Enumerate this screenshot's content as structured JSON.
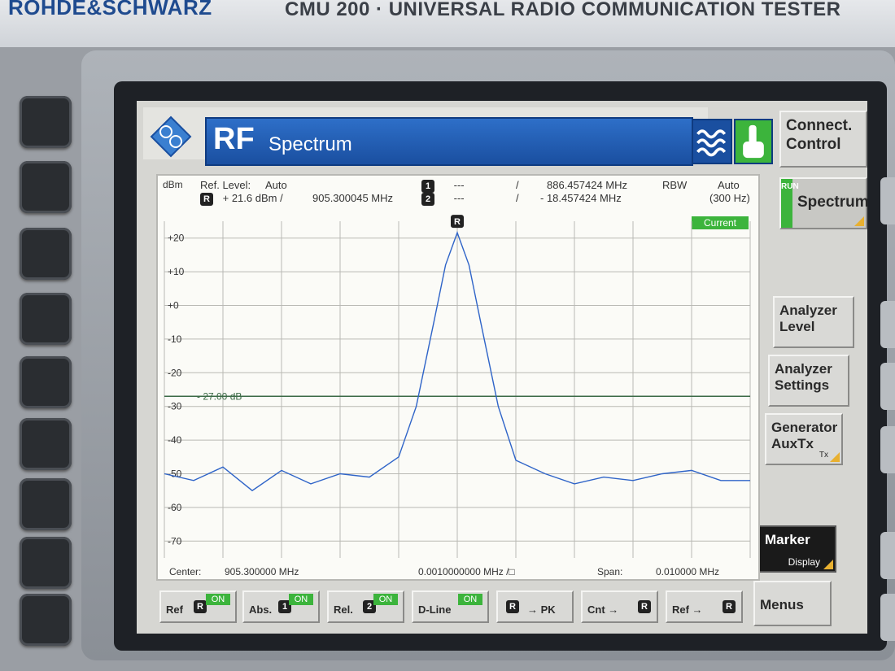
{
  "bezel": {
    "brand": "ROHDE&SCHWARZ",
    "model": "CMU 200 · UNIVERSAL RADIO COMMUNICATION TESTER"
  },
  "header": {
    "title_rf": "RF",
    "title_sub": "Spectrum",
    "connect_control": "Connect. Control"
  },
  "side_menu": {
    "run_letters": "RUN",
    "spectrum": "Spectrum",
    "analyzer_level": "Analyzer Level",
    "analyzer_settings": "Analyzer Settings",
    "generator": "Generator AuxTx",
    "generator_sub": "Tx",
    "marker": "Marker",
    "marker_sub": "Display",
    "menus": "Menus"
  },
  "readout": {
    "unit": "dBm",
    "ref_level_label": "Ref. Level:",
    "ref_level_value": "Auto",
    "ref_marker": "+ 21.6  dBm  /",
    "ref_freq": "905.300045  MHz",
    "m1_value": "---",
    "m1_freq": "886.457424   MHz",
    "m2_value": "---",
    "m2_freq": "- 18.457424   MHz",
    "rbw_label": "RBW",
    "rbw_value": "Auto",
    "rbw_detail": "(300 Hz)",
    "slash": "/",
    "current": "Current",
    "dline": "- 27.00 dB"
  },
  "bottom_info": {
    "center_label": "Center:",
    "center_value": "905.300000  MHz",
    "div_value": "0.0010000000 MHz  /□",
    "span_label": "Span:",
    "span_value": "0.010000  MHz"
  },
  "bottom_buttons": [
    {
      "label": "Ref",
      "on": "ON"
    },
    {
      "label": "Abs.",
      "on": "ON"
    },
    {
      "label": "Rel.",
      "on": "ON"
    },
    {
      "label": "D-Line",
      "on": "ON"
    },
    {
      "label": "→ PK"
    },
    {
      "label": "Cnt →"
    },
    {
      "label": "Ref →"
    }
  ],
  "chart_data": {
    "type": "line",
    "ylabel": "dBm",
    "ylim": [
      -75,
      25
    ],
    "yticks": [
      "+20",
      "+10",
      "+0",
      "-10",
      "-20",
      "-30",
      "-40",
      "-50",
      "-60",
      "-70"
    ],
    "x_center_mhz": 905.3,
    "x_span_mhz": 0.01,
    "dline_db": -27,
    "series": [
      {
        "x": [
          905.295,
          905.2955,
          905.296,
          905.2965,
          905.297,
          905.2975,
          905.298,
          905.2985,
          905.299,
          905.2993,
          905.2996,
          905.2998,
          905.3,
          905.3002,
          905.3004,
          905.3007,
          905.301,
          905.3015,
          905.302,
          905.3025,
          905.303,
          905.3035,
          905.304,
          905.3045,
          905.305
        ],
        "y": [
          -50,
          -52,
          -48,
          -55,
          -49,
          -53,
          -50,
          -51,
          -45,
          -30,
          -5,
          12,
          21.6,
          12,
          -5,
          -30,
          -46,
          -50,
          -53,
          -51,
          -52,
          -50,
          -49,
          -52,
          -52
        ]
      }
    ]
  },
  "colors": {
    "trace": "#2f64c8",
    "grid": "#b9b9b4",
    "accent": "#1a4fa0",
    "on": "#3cb43c"
  }
}
